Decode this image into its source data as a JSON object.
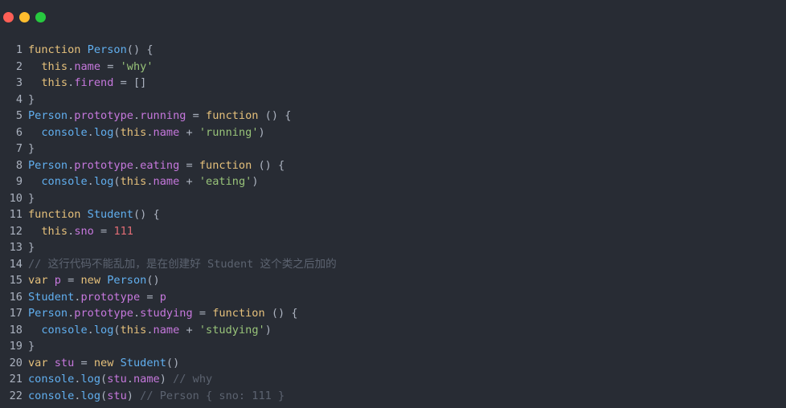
{
  "window": {
    "controls": [
      {
        "name": "close",
        "color": "#ff5f56"
      },
      {
        "name": "minimize",
        "color": "#ffbd2e"
      },
      {
        "name": "maximize",
        "color": "#27c93f"
      }
    ]
  },
  "colors": {
    "background": "#282c34",
    "keyword": "#e5c07b",
    "function": "#61afef",
    "property": "#c678dd",
    "string": "#98c379",
    "number": "#e06c75",
    "comment": "#5c6370",
    "text": "#abb2bf"
  },
  "code": {
    "lines": [
      {
        "n": "1",
        "tokens": [
          {
            "t": "kw",
            "v": "function"
          },
          {
            "t": "txt",
            "v": " "
          },
          {
            "t": "fn",
            "v": "Person"
          },
          {
            "t": "txt",
            "v": "() {"
          }
        ]
      },
      {
        "n": "2",
        "tokens": [
          {
            "t": "txt",
            "v": "  "
          },
          {
            "t": "kw",
            "v": "this"
          },
          {
            "t": "txt",
            "v": "."
          },
          {
            "t": "prop",
            "v": "name"
          },
          {
            "t": "txt",
            "v": " = "
          },
          {
            "t": "str",
            "v": "'why'"
          }
        ]
      },
      {
        "n": "3",
        "tokens": [
          {
            "t": "txt",
            "v": "  "
          },
          {
            "t": "kw",
            "v": "this"
          },
          {
            "t": "txt",
            "v": "."
          },
          {
            "t": "prop",
            "v": "firend"
          },
          {
            "t": "txt",
            "v": " = []"
          }
        ]
      },
      {
        "n": "4",
        "tokens": [
          {
            "t": "txt",
            "v": "}"
          }
        ]
      },
      {
        "n": "5",
        "tokens": [
          {
            "t": "cls",
            "v": "Person"
          },
          {
            "t": "txt",
            "v": "."
          },
          {
            "t": "prop",
            "v": "prototype"
          },
          {
            "t": "txt",
            "v": "."
          },
          {
            "t": "prop",
            "v": "running"
          },
          {
            "t": "txt",
            "v": " = "
          },
          {
            "t": "kw",
            "v": "function"
          },
          {
            "t": "txt",
            "v": " () {"
          }
        ]
      },
      {
        "n": "6",
        "tokens": [
          {
            "t": "txt",
            "v": "  "
          },
          {
            "t": "fn",
            "v": "console"
          },
          {
            "t": "txt",
            "v": "."
          },
          {
            "t": "fn",
            "v": "log"
          },
          {
            "t": "txt",
            "v": "("
          },
          {
            "t": "kw",
            "v": "this"
          },
          {
            "t": "txt",
            "v": "."
          },
          {
            "t": "prop",
            "v": "name"
          },
          {
            "t": "txt",
            "v": " + "
          },
          {
            "t": "str",
            "v": "'running'"
          },
          {
            "t": "txt",
            "v": ")"
          }
        ]
      },
      {
        "n": "7",
        "tokens": [
          {
            "t": "txt",
            "v": "}"
          }
        ]
      },
      {
        "n": "8",
        "tokens": [
          {
            "t": "cls",
            "v": "Person"
          },
          {
            "t": "txt",
            "v": "."
          },
          {
            "t": "prop",
            "v": "prototype"
          },
          {
            "t": "txt",
            "v": "."
          },
          {
            "t": "prop",
            "v": "eating"
          },
          {
            "t": "txt",
            "v": " = "
          },
          {
            "t": "kw",
            "v": "function"
          },
          {
            "t": "txt",
            "v": " () {"
          }
        ]
      },
      {
        "n": "9",
        "tokens": [
          {
            "t": "txt",
            "v": "  "
          },
          {
            "t": "fn",
            "v": "console"
          },
          {
            "t": "txt",
            "v": "."
          },
          {
            "t": "fn",
            "v": "log"
          },
          {
            "t": "txt",
            "v": "("
          },
          {
            "t": "kw",
            "v": "this"
          },
          {
            "t": "txt",
            "v": "."
          },
          {
            "t": "prop",
            "v": "name"
          },
          {
            "t": "txt",
            "v": " + "
          },
          {
            "t": "str",
            "v": "'eating'"
          },
          {
            "t": "txt",
            "v": ")"
          }
        ]
      },
      {
        "n": "10",
        "tokens": [
          {
            "t": "txt",
            "v": "}"
          }
        ]
      },
      {
        "n": "11",
        "tokens": [
          {
            "t": "kw",
            "v": "function"
          },
          {
            "t": "txt",
            "v": " "
          },
          {
            "t": "fn",
            "v": "Student"
          },
          {
            "t": "txt",
            "v": "() {"
          }
        ]
      },
      {
        "n": "12",
        "tokens": [
          {
            "t": "txt",
            "v": "  "
          },
          {
            "t": "kw",
            "v": "this"
          },
          {
            "t": "txt",
            "v": "."
          },
          {
            "t": "prop",
            "v": "sno"
          },
          {
            "t": "txt",
            "v": " = "
          },
          {
            "t": "num",
            "v": "111"
          }
        ]
      },
      {
        "n": "13",
        "tokens": [
          {
            "t": "txt",
            "v": "}"
          }
        ]
      },
      {
        "n": "14",
        "tokens": [
          {
            "t": "com",
            "v": "// 这行代码不能乱加，是在创建好 Student 这个类之后加的"
          }
        ]
      },
      {
        "n": "15",
        "tokens": [
          {
            "t": "kw",
            "v": "var"
          },
          {
            "t": "txt",
            "v": " "
          },
          {
            "t": "var",
            "v": "p"
          },
          {
            "t": "txt",
            "v": " = "
          },
          {
            "t": "kw",
            "v": "new"
          },
          {
            "t": "txt",
            "v": " "
          },
          {
            "t": "fn",
            "v": "Person"
          },
          {
            "t": "txt",
            "v": "()"
          }
        ]
      },
      {
        "n": "16",
        "tokens": [
          {
            "t": "cls",
            "v": "Student"
          },
          {
            "t": "txt",
            "v": "."
          },
          {
            "t": "prop",
            "v": "prototype"
          },
          {
            "t": "txt",
            "v": " = "
          },
          {
            "t": "var",
            "v": "p"
          }
        ]
      },
      {
        "n": "17",
        "tokens": [
          {
            "t": "cls",
            "v": "Person"
          },
          {
            "t": "txt",
            "v": "."
          },
          {
            "t": "prop",
            "v": "prototype"
          },
          {
            "t": "txt",
            "v": "."
          },
          {
            "t": "prop",
            "v": "studying"
          },
          {
            "t": "txt",
            "v": " = "
          },
          {
            "t": "kw",
            "v": "function"
          },
          {
            "t": "txt",
            "v": " () {"
          }
        ]
      },
      {
        "n": "18",
        "tokens": [
          {
            "t": "txt",
            "v": "  "
          },
          {
            "t": "fn",
            "v": "console"
          },
          {
            "t": "txt",
            "v": "."
          },
          {
            "t": "fn",
            "v": "log"
          },
          {
            "t": "txt",
            "v": "("
          },
          {
            "t": "kw",
            "v": "this"
          },
          {
            "t": "txt",
            "v": "."
          },
          {
            "t": "prop",
            "v": "name"
          },
          {
            "t": "txt",
            "v": " + "
          },
          {
            "t": "str",
            "v": "'studying'"
          },
          {
            "t": "txt",
            "v": ")"
          }
        ]
      },
      {
        "n": "19",
        "tokens": [
          {
            "t": "txt",
            "v": "}"
          }
        ]
      },
      {
        "n": "20",
        "tokens": [
          {
            "t": "kw",
            "v": "var"
          },
          {
            "t": "txt",
            "v": " "
          },
          {
            "t": "var",
            "v": "stu"
          },
          {
            "t": "txt",
            "v": " = "
          },
          {
            "t": "kw",
            "v": "new"
          },
          {
            "t": "txt",
            "v": " "
          },
          {
            "t": "fn",
            "v": "Student"
          },
          {
            "t": "txt",
            "v": "()"
          }
        ]
      },
      {
        "n": "21",
        "tokens": [
          {
            "t": "fn",
            "v": "console"
          },
          {
            "t": "txt",
            "v": "."
          },
          {
            "t": "fn",
            "v": "log"
          },
          {
            "t": "txt",
            "v": "("
          },
          {
            "t": "var",
            "v": "stu"
          },
          {
            "t": "txt",
            "v": "."
          },
          {
            "t": "prop",
            "v": "name"
          },
          {
            "t": "txt",
            "v": ") "
          },
          {
            "t": "com",
            "v": "// why"
          }
        ]
      },
      {
        "n": "22",
        "tokens": [
          {
            "t": "fn",
            "v": "console"
          },
          {
            "t": "txt",
            "v": "."
          },
          {
            "t": "fn",
            "v": "log"
          },
          {
            "t": "txt",
            "v": "("
          },
          {
            "t": "var",
            "v": "stu"
          },
          {
            "t": "txt",
            "v": ") "
          },
          {
            "t": "com",
            "v": "// Person { sno: 111 }"
          }
        ]
      }
    ]
  }
}
